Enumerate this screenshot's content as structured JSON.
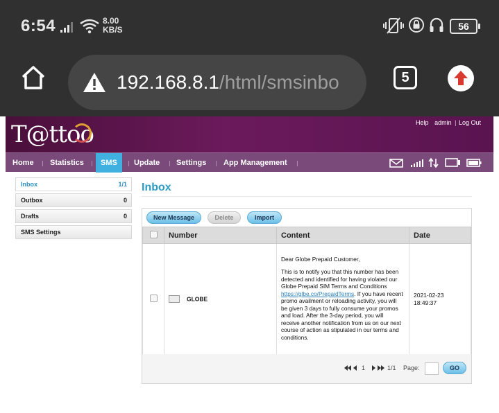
{
  "status_bar": {
    "time": "6:54",
    "net_speed_value": "8.00",
    "net_speed_unit": "KB/S",
    "battery": "56"
  },
  "browser": {
    "url_host": "192.168.8.1",
    "url_path": "/html/smsinbo",
    "tab_count": "5"
  },
  "router": {
    "brand": "T@ttoo",
    "top_links": [
      "Help",
      "admin",
      "Log Out"
    ],
    "nav": [
      "Home",
      "Statistics",
      "SMS",
      "Update",
      "Settings",
      "App Management"
    ],
    "active_nav": "SMS",
    "sidebar": [
      {
        "label": "Inbox",
        "count": "1/1"
      },
      {
        "label": "Outbox",
        "count": "0"
      },
      {
        "label": "Drafts",
        "count": "0"
      },
      {
        "label": "SMS Settings",
        "count": ""
      }
    ],
    "page_title": "Inbox",
    "toolbar": {
      "new_message": "New Message",
      "delete": "Delete",
      "import": "Import"
    },
    "columns": [
      "Number",
      "Content",
      "Date"
    ],
    "message": {
      "number": "GLOBE",
      "greeting": "Dear Globe Prepaid Customer,",
      "body_before_link": "This is to notify you that this number has been detected and identified for having violated our Globe Prepaid SIM Terms and Conditions ",
      "link": "https://glbe.co/PrepaidTerms",
      "body_after_link": ". If you have recent promo availment or reloading activity, you will be given 3 days to fully consume your promos and load. After the 3-day period, you will receive another notification from us on our next course of action as stipulated in our terms and conditions.",
      "date": "2021-02-23",
      "time": "18:49:37"
    },
    "pager": {
      "current": "1",
      "page_of": "1/1",
      "page_label": "Page:",
      "go": "GO"
    }
  },
  "colors": {
    "statusbar_bg": "#303030",
    "banner": "#5a1450",
    "nav_bg": "#7a4a7a",
    "nav_active": "#3fb0e0",
    "title": "#2d9cc6",
    "button_blue": "#6cc0e8",
    "upload_red": "#d93a2f"
  }
}
